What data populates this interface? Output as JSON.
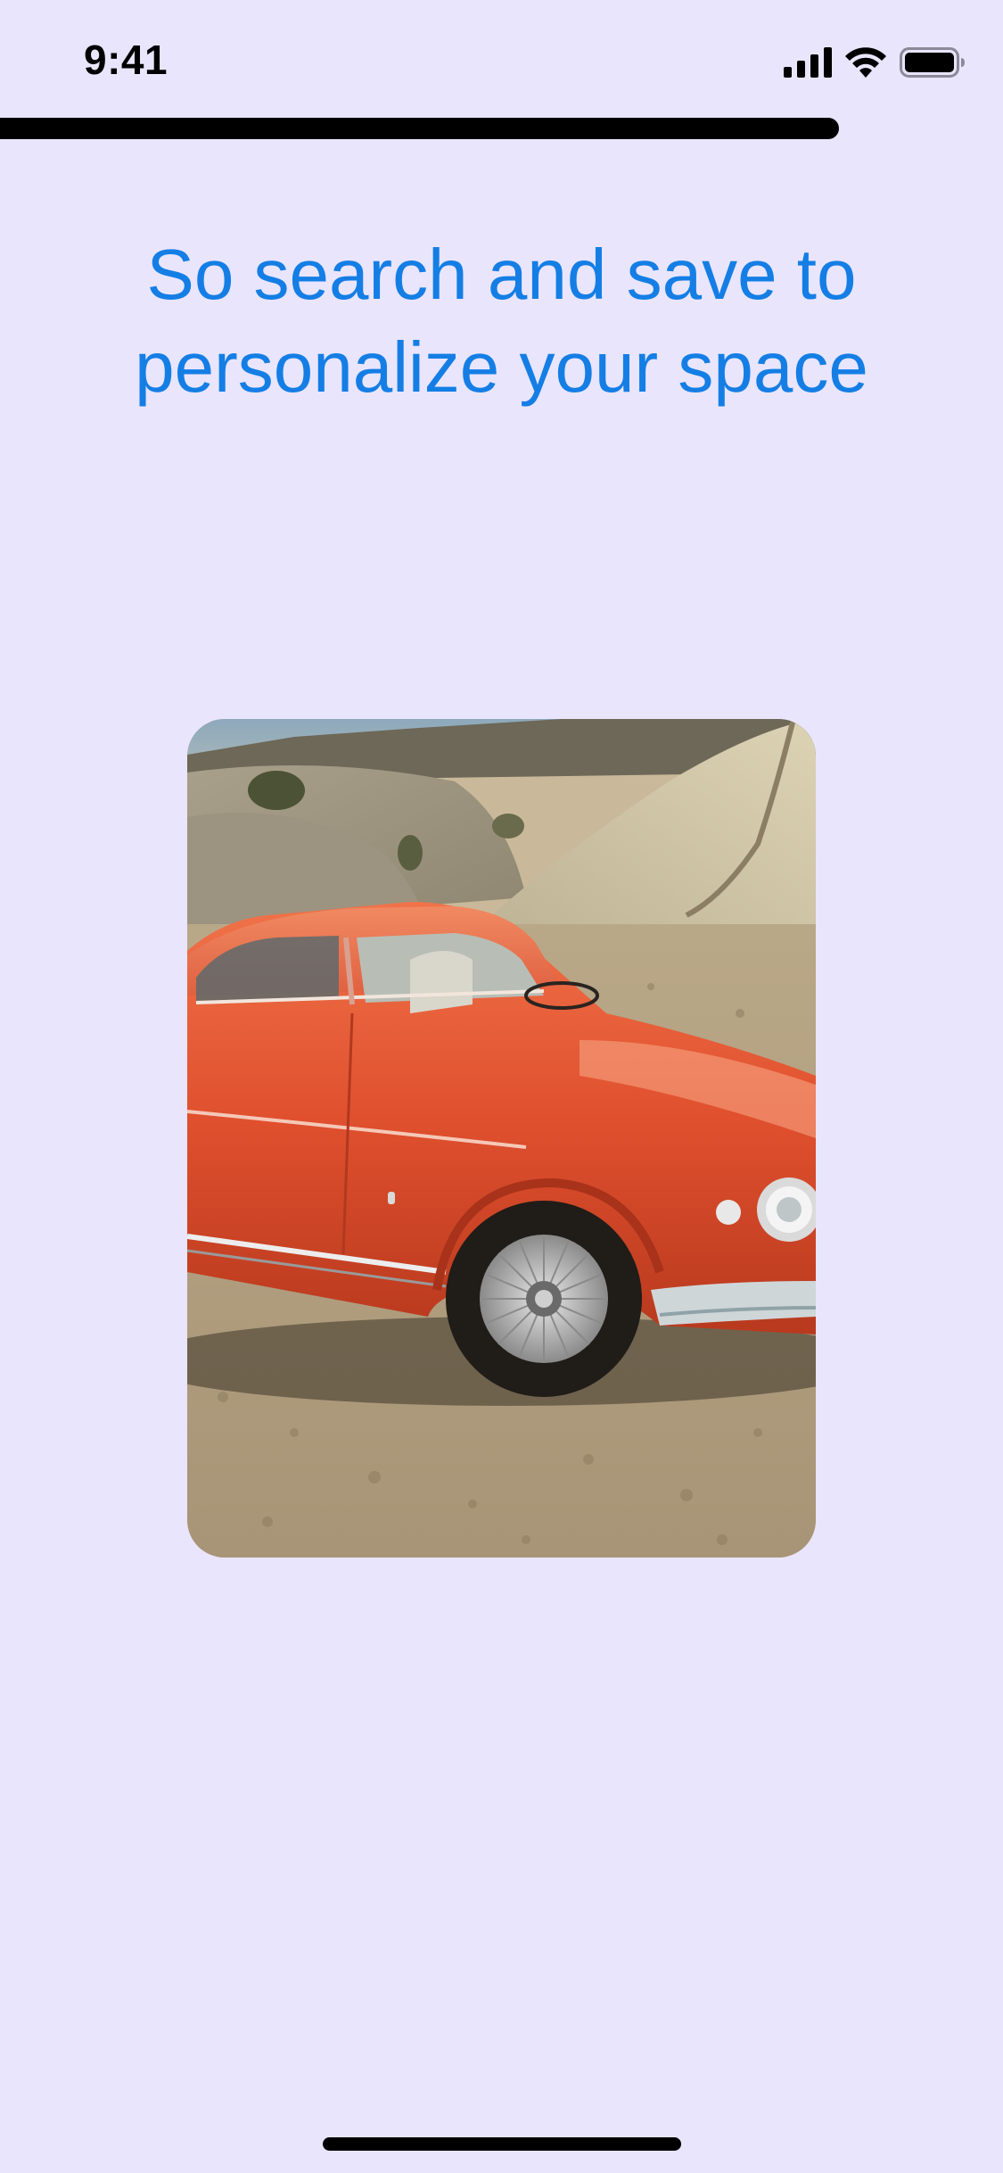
{
  "status_bar": {
    "time": "9:41",
    "icons": [
      "cellular-signal-icon",
      "wifi-icon",
      "battery-icon"
    ]
  },
  "onboarding": {
    "progress_fraction": 0.836,
    "headline_line1": "So search and save to",
    "headline_line2": "personalize your space",
    "image": "vintage-red-sports-car-photo"
  },
  "colors": {
    "background": "#E9E5FD",
    "headline": "#147EE5",
    "progress": "#000000",
    "car_body": "#E0502E"
  }
}
